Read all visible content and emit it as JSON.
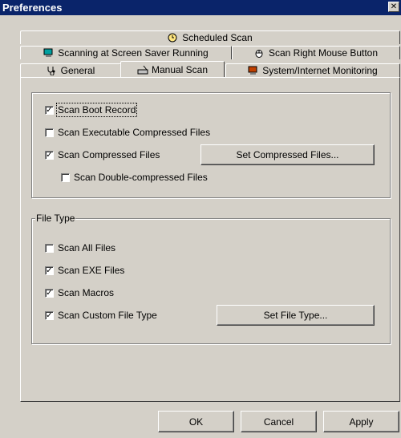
{
  "window": {
    "title": "Preferences"
  },
  "tabs": {
    "row1": [
      {
        "label": "Scheduled Scan",
        "icon": "clock-icon"
      }
    ],
    "row2": [
      {
        "label": "Scanning at Screen Saver Running",
        "icon": "monitor-icon"
      },
      {
        "label": "Scan Right Mouse Button",
        "icon": "mouse-icon"
      }
    ],
    "row3": [
      {
        "label": "General",
        "icon": "stethoscope-icon"
      },
      {
        "label": "Manual Scan",
        "icon": "scanner-icon"
      },
      {
        "label": "System/Internet Monitoring",
        "icon": "monitor-icon"
      }
    ]
  },
  "scan_options": {
    "boot_record": {
      "label": "Scan Boot Record",
      "checked": true
    },
    "executable_compressed": {
      "label": "Scan Executable Compressed Files",
      "checked": false
    },
    "compressed": {
      "label": "Scan Compressed Files",
      "checked": true
    },
    "set_compressed_button": "Set Compressed Files...",
    "double_compressed": {
      "label": "Scan Double-compressed Files",
      "checked": false
    }
  },
  "file_type": {
    "legend": "File Type",
    "all_files": {
      "label": "Scan All Files",
      "checked": false
    },
    "exe_files": {
      "label": "Scan EXE Files",
      "checked": true
    },
    "macros": {
      "label": "Scan Macros",
      "checked": true
    },
    "custom": {
      "label": "Scan Custom File Type",
      "checked": true
    },
    "set_file_type_button": "Set File Type..."
  },
  "footer": {
    "ok": "OK",
    "cancel": "Cancel",
    "apply": "Apply"
  }
}
